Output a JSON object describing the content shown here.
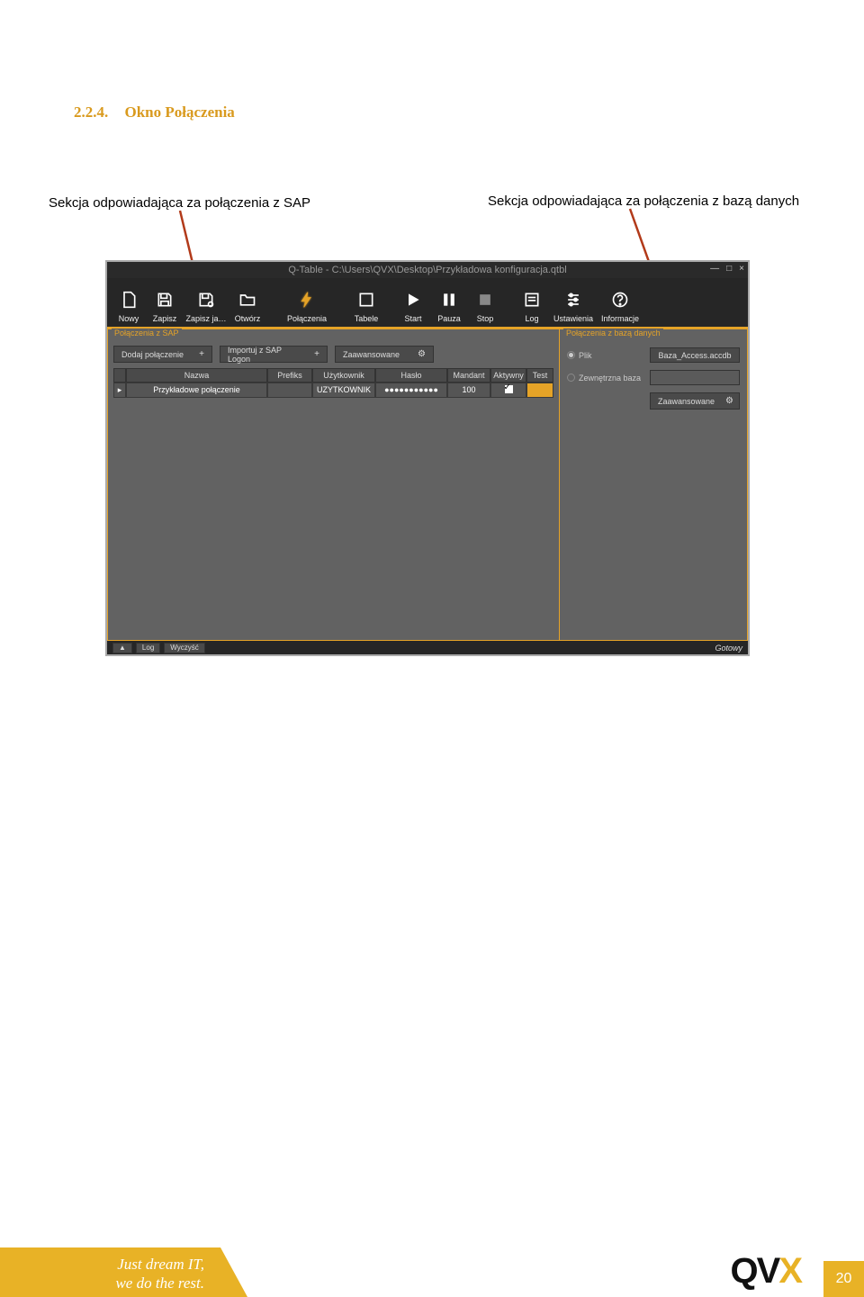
{
  "heading": {
    "num": "2.2.4.",
    "title": "Okno Połączenia"
  },
  "annotations": {
    "sap": "Sekcja odpowiadająca za połączenia z SAP",
    "db": "Sekcja odpowiadająca za połączenia z bazą danych"
  },
  "window": {
    "title": "Q-Table - C:\\Users\\QVX\\Desktop\\Przykładowa konfiguracja.qtbl",
    "controls": {
      "min": "—",
      "max": "□",
      "close": "×"
    },
    "toolbar": {
      "new": "Nowy",
      "save": "Zapisz",
      "saveAs": "Zapisz ja…",
      "open": "Otwórz",
      "connections": "Połączenia",
      "tables": "Tabele",
      "start": "Start",
      "pause": "Pauza",
      "stop": "Stop",
      "log": "Log",
      "settings": "Ustawienia",
      "info": "Informacje"
    },
    "sapPanel": {
      "title": "Połączenia z SAP",
      "addBtn": "Dodaj połączenie",
      "importBtn": "Importuj z SAP Logon",
      "advBtn": "Zaawansowane",
      "columns": [
        "",
        "Nazwa",
        "Prefiks",
        "Użytkownik",
        "Hasło",
        "Mandant",
        "Aktywny",
        "Test"
      ],
      "row": {
        "marker": "▸",
        "name": "Przykładowe połączenie",
        "prefix": "",
        "user": "UZYTKOWNIK",
        "pass": "●●●●●●●●●●●",
        "mandant": "100",
        "active": true,
        "test": ""
      }
    },
    "dbPanel": {
      "title": "Połączenia z bazą danych",
      "fileOpt": "Plik",
      "extOpt": "Zewnętrzna baza",
      "fileVal": "Baza_Access.accdb",
      "advBtn": "Zaawansowane"
    },
    "status": {
      "up": "▲",
      "log": "Log",
      "clear": "Wyczyść",
      "ready": "Gotowy"
    }
  },
  "footer": {
    "line1": "Just dream IT,",
    "line2": "we do the rest.",
    "page": "20",
    "logo": {
      "q": "Q",
      "v": "V",
      "x": "X"
    }
  }
}
